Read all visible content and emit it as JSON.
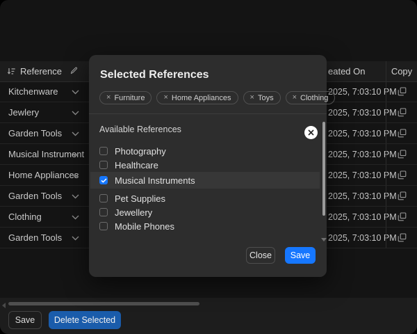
{
  "table": {
    "header": {
      "reference": "Reference",
      "created_on": "eated On",
      "copy": "Copy"
    },
    "rows": [
      {
        "reference": "Kitchenware",
        "created_on": "2025, 7:03:10 PM"
      },
      {
        "reference": "Jewlery",
        "created_on": "2025, 7:03:10 PM"
      },
      {
        "reference": "Garden Tools",
        "created_on": "2025, 7:03:10 PM"
      },
      {
        "reference": "Musical Instrument",
        "created_on": "2025, 7:03:10 PM"
      },
      {
        "reference": "Home Appliances",
        "created_on": "2025, 7:03:10 PM"
      },
      {
        "reference": "Garden Tools",
        "created_on": "2025, 7:03:10 PM"
      },
      {
        "reference": "Clothing",
        "created_on": "2025, 7:03:10 PM"
      },
      {
        "reference": "Garden Tools",
        "created_on": "2025, 7:03:10 PM"
      }
    ]
  },
  "modal": {
    "title": "Selected References",
    "tags": [
      {
        "label": "Furniture"
      },
      {
        "label": "Home Appliances"
      },
      {
        "label": "Toys"
      },
      {
        "label": "Clothing"
      }
    ],
    "available_label": "Available References",
    "options": [
      {
        "label": "Photography",
        "checked": false
      },
      {
        "label": "Healthcare",
        "checked": false
      },
      {
        "label": "Musical Instruments",
        "checked": true
      },
      {
        "label": "Pet Supplies",
        "checked": false
      },
      {
        "label": "Jewellery",
        "checked": false
      },
      {
        "label": "Mobile Phones",
        "checked": false
      }
    ],
    "close_label": "Close",
    "save_label": "Save"
  },
  "footer": {
    "save_label": "Save",
    "delete_selected_label": "Delete Selected"
  },
  "colors": {
    "accent_blue": "#1677ff",
    "delete_button_blue": "#1a5cab",
    "modal_bg": "#2d2d2d",
    "window_bg": "#141414"
  }
}
